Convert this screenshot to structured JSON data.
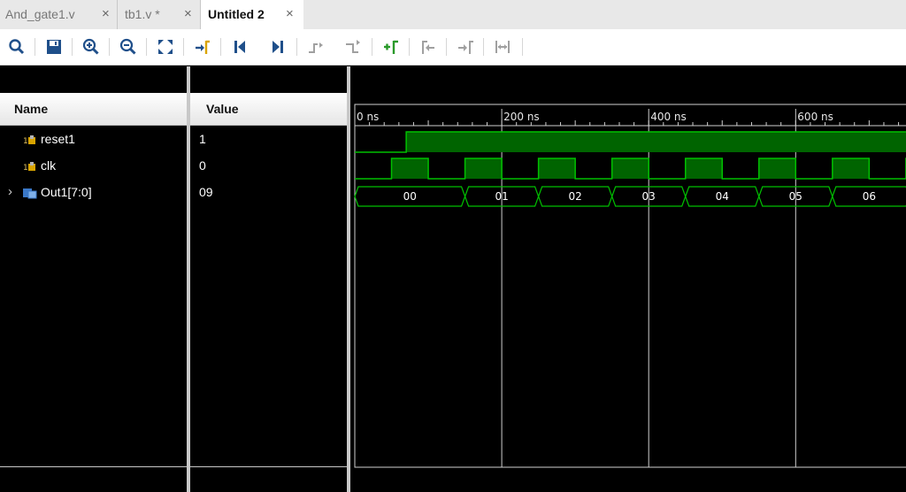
{
  "tabs": [
    {
      "label": "And_gate1.v",
      "close": "×"
    },
    {
      "label": "tb1.v *",
      "close": "×"
    },
    {
      "label": "Untitled 2",
      "close": "×"
    }
  ],
  "toolbar": {
    "icons": [
      "search-icon",
      "save-icon",
      "zoom-in-icon",
      "zoom-out-icon",
      "zoom-fit-icon",
      "go-to-cursor-icon",
      "go-to-start-icon",
      "go-to-end-icon",
      "previous-transition-icon",
      "next-transition-icon",
      "add-marker-icon",
      "previous-marker-icon",
      "next-marker-icon",
      "swap-cursors-icon"
    ]
  },
  "columns": {
    "name": "Name",
    "value": "Value"
  },
  "signals": [
    {
      "name": "reset1",
      "value": "1",
      "expandable": false,
      "type": "bit"
    },
    {
      "name": "clk",
      "value": "0",
      "expandable": false,
      "type": "bit"
    },
    {
      "name": "Out1[7:0]",
      "value": "09",
      "expandable": true,
      "expand_glyph": "›",
      "type": "bus"
    }
  ],
  "waveform": {
    "time_unit": "ns",
    "time_labels": [
      {
        "t": 0,
        "text": "0 ns"
      },
      {
        "t": 200,
        "text": "200 ns"
      },
      {
        "t": 400,
        "text": "400 ns"
      },
      {
        "t": 600,
        "text": "600 ns"
      }
    ],
    "visible_range_ns": [
      0,
      756
    ],
    "minor_tick_ns": 20,
    "cursor_lines_ns": [
      200,
      400,
      600
    ],
    "reset1_rise_ns": 70,
    "clk_period_ns": 100,
    "clk_first_high_ns": 50,
    "bus_segments": [
      {
        "t0": 0,
        "t1": 150,
        "label": "00"
      },
      {
        "t0": 150,
        "t1": 250,
        "label": "01"
      },
      {
        "t0": 250,
        "t1": 350,
        "label": "02"
      },
      {
        "t0": 350,
        "t1": 450,
        "label": "03"
      },
      {
        "t0": 450,
        "t1": 550,
        "label": "04"
      },
      {
        "t0": 550,
        "t1": 650,
        "label": "05"
      },
      {
        "t0": 650,
        "t1": 756,
        "label": "06"
      }
    ],
    "colors": {
      "signal": "#00c000",
      "fill": "#006400",
      "grid": "#cfcfcf",
      "background": "#000000"
    }
  }
}
